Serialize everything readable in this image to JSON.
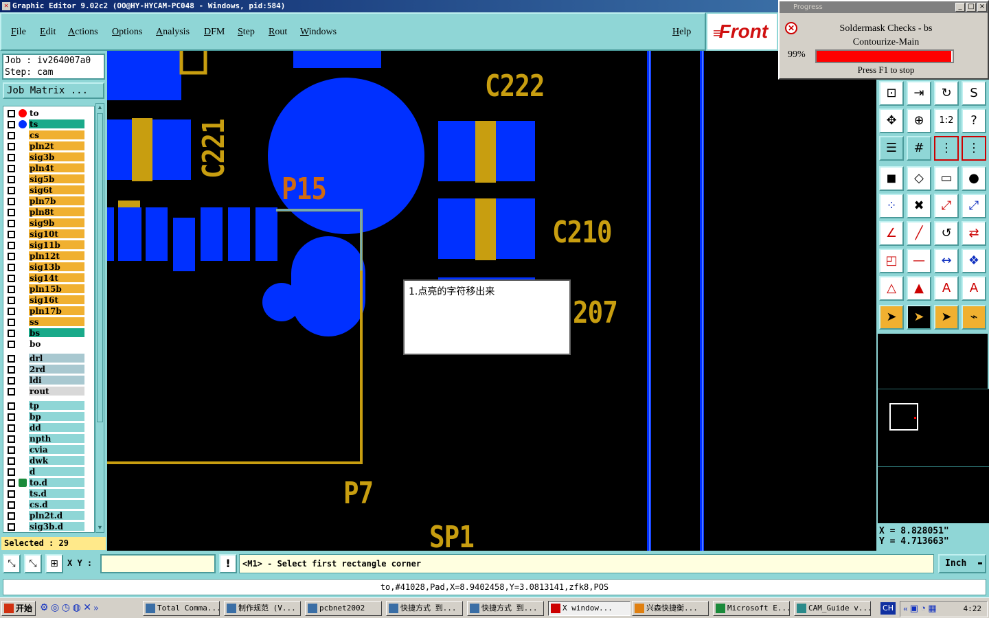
{
  "window": {
    "title": "Graphic Editor 9.02c2 (OO@HY-HYCAM-PC048 - Windows, pid:584)"
  },
  "menu": [
    "File",
    "Edit",
    "Actions",
    "Options",
    "Analysis",
    "DFM",
    "Step",
    "Rout",
    "Windows"
  ],
  "menu_help": "Help",
  "logo_text": "Front",
  "progress": {
    "window_title": "Progress",
    "check_title": "Soldermask Checks - bs",
    "subtitle": "Contourize-Main",
    "percent_text": "99%",
    "percent": 99,
    "bar_color": "#ff0000",
    "stop_hint": "Press F1 to stop"
  },
  "job": {
    "job_line": "Job : iv264007a0",
    "step_line": "Step: cam",
    "matrix_button": "Job Matrix ..."
  },
  "layers": [
    {
      "name": "to",
      "color": "#ffffff",
      "marker": "red-dot-icon"
    },
    {
      "name": "ts",
      "color": "#1aaa8a",
      "marker": "blue-dot-icon"
    },
    {
      "name": "cs",
      "color": "#f0b030",
      "marker": ""
    },
    {
      "name": "pln2t",
      "color": "#f0b030",
      "marker": ""
    },
    {
      "name": "sig3b",
      "color": "#f0b030",
      "marker": ""
    },
    {
      "name": "pln4t",
      "color": "#f0b030",
      "marker": ""
    },
    {
      "name": "sig5b",
      "color": "#f0b030",
      "marker": ""
    },
    {
      "name": "sig6t",
      "color": "#f0b030",
      "marker": ""
    },
    {
      "name": "pln7b",
      "color": "#f0b030",
      "marker": ""
    },
    {
      "name": "pln8t",
      "color": "#f0b030",
      "marker": ""
    },
    {
      "name": "sig9b",
      "color": "#f0b030",
      "marker": ""
    },
    {
      "name": "sig10t",
      "color": "#f0b030",
      "marker": ""
    },
    {
      "name": "sig11b",
      "color": "#f0b030",
      "marker": ""
    },
    {
      "name": "pln12t",
      "color": "#f0b030",
      "marker": ""
    },
    {
      "name": "sig13b",
      "color": "#f0b030",
      "marker": ""
    },
    {
      "name": "sig14t",
      "color": "#f0b030",
      "marker": ""
    },
    {
      "name": "pln15b",
      "color": "#f0b030",
      "marker": ""
    },
    {
      "name": "sig16t",
      "color": "#f0b030",
      "marker": ""
    },
    {
      "name": "pln17b",
      "color": "#f0b030",
      "marker": ""
    },
    {
      "name": "ss",
      "color": "#f0b030",
      "marker": ""
    },
    {
      "name": "bs",
      "color": "#1aaa8a",
      "marker": ""
    },
    {
      "name": "bo",
      "color": "#ffffff",
      "marker": ""
    },
    {
      "name": "drl",
      "color": "#a8c8d0",
      "marker": ""
    },
    {
      "name": "2rd",
      "color": "#a8c8d0",
      "marker": ""
    },
    {
      "name": "ldi",
      "color": "#a8c8d0",
      "marker": ""
    },
    {
      "name": "rout",
      "color": "#d8d8d8",
      "marker": ""
    },
    {
      "name": "tp",
      "color": "#8fd6d6",
      "marker": ""
    },
    {
      "name": "bp",
      "color": "#8fd6d6",
      "marker": ""
    },
    {
      "name": "dd",
      "color": "#8fd6d6",
      "marker": ""
    },
    {
      "name": "npth",
      "color": "#8fd6d6",
      "marker": ""
    },
    {
      "name": "cvia",
      "color": "#8fd6d6",
      "marker": ""
    },
    {
      "name": "dwk",
      "color": "#8fd6d6",
      "marker": ""
    },
    {
      "name": "d",
      "color": "#8fd6d6",
      "marker": ""
    },
    {
      "name": "to.d",
      "color": "#8fd6d6",
      "marker": "arrow-icon"
    },
    {
      "name": "ts.d",
      "color": "#8fd6d6",
      "marker": ""
    },
    {
      "name": "cs.d",
      "color": "#8fd6d6",
      "marker": ""
    },
    {
      "name": "pln2t.d",
      "color": "#8fd6d6",
      "marker": ""
    },
    {
      "name": "sig3b.d",
      "color": "#8fd6d6",
      "marker": ""
    }
  ],
  "selected_text": "Selected : 29",
  "canvas": {
    "labels": [
      "C222",
      "C221",
      "P15",
      "C210",
      "207",
      "P7",
      "SP1"
    ],
    "note": "1.点亮的字符移出来",
    "pad_color": "#0030ff",
    "silk_color": "#c89e10"
  },
  "coords": {
    "x": "X = 8.828051\"",
    "y": "Y = 4.713663\""
  },
  "command": {
    "xy_label": "X Y :",
    "xy_value": "",
    "prompt": "<M1> - Select first rectangle corner",
    "units": "Inch"
  },
  "status": "to,#41028,Pad,X=8.9402458,Y=3.0813141,zfk8,POS",
  "taskbar": {
    "start": "开始",
    "items": [
      "Total Comma...",
      "制作规范 (V...",
      "pcbnet2002",
      "快捷方式 到...",
      "快捷方式 到...",
      "X window...",
      "兴森快捷衡...",
      "Microsoft E...",
      "CAM_Guide v..."
    ],
    "lang": "CH",
    "clock": "4:22"
  }
}
